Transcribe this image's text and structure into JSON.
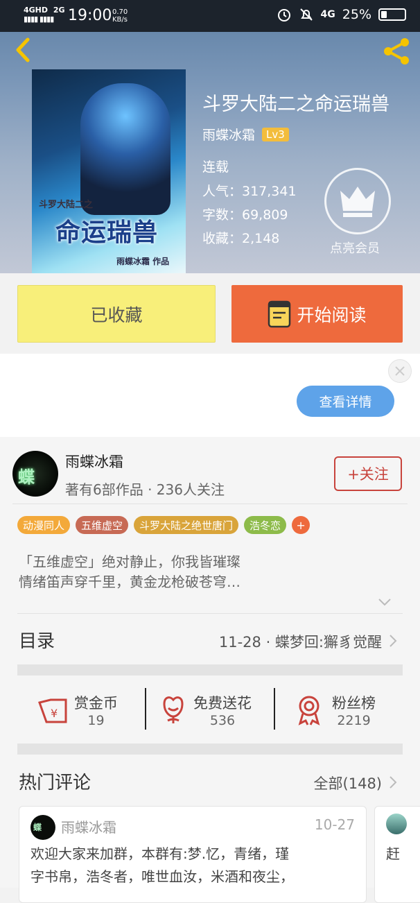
{
  "status_bar": {
    "network_line1": "4GHD",
    "network_line2": "2G",
    "time": "19:00",
    "speed_value": "0.70",
    "speed_unit": "KB/s",
    "signal_right": "4G",
    "battery": "25%"
  },
  "header": {
    "back_icon": "chevron-left-icon",
    "share_icon": "share-icon"
  },
  "book": {
    "cover_text_series": "斗罗大陆二之",
    "cover_text_title": "命运瑞兽",
    "cover_text_author": "雨蝶冰霜 作品",
    "title": "斗罗大陆二之命运瑞兽",
    "author": "雨蝶冰霜",
    "author_level": "Lv3",
    "status": "连载",
    "popularity": "人气：317,341",
    "word_count": "字数：69,809",
    "favorites": "收藏：2,148",
    "vip_label": "点亮会员"
  },
  "actions": {
    "favorited_label": "已收藏",
    "read_label": "开始阅读"
  },
  "ad": {
    "details_label": "查看详情"
  },
  "author_card": {
    "avatar_text": "蝶",
    "name": "雨蝶冰霜",
    "subtitle": "著有6部作品 · 236人关注",
    "follow_label": "+关注"
  },
  "tags": [
    {
      "label": "动漫同人",
      "color": "#f3a93a"
    },
    {
      "label": "五维虚空",
      "color": "#c76a55"
    },
    {
      "label": "斗罗大陆之绝世唐门",
      "color": "#d9a43a"
    },
    {
      "label": "浩冬恋",
      "color": "#8dbb4a"
    }
  ],
  "tag_more": "+",
  "description": {
    "line1": "「五维虚空」绝对静止，你我皆璀璨",
    "line2": "情绪笛声穿千里，黄金龙枪破苍穹…"
  },
  "toc": {
    "title": "目录",
    "latest": "11-28 · 蝶梦回:獬豸觉醒"
  },
  "stats": [
    {
      "label": "赏金币",
      "value": "19",
      "icon": "coin-envelope-icon"
    },
    {
      "label": "免费送花",
      "value": "536",
      "icon": "flower-icon"
    },
    {
      "label": "粉丝榜",
      "value": "2219",
      "icon": "medal-icon"
    }
  ],
  "comments": {
    "title": "热门评论",
    "all_label": "全部(148)",
    "items": [
      {
        "name": "雨蝶冰霜",
        "date": "10-27",
        "line1": "欢迎大家来加群，本群有:梦.忆，青绪，瑾",
        "line2": "字书帛，浩冬者，唯世血汝，米酒和夜尘，"
      },
      {
        "text": "赶"
      }
    ]
  },
  "colors": {
    "accent_orange": "#ee6a3d",
    "favorited_yellow": "#f8ef7a",
    "follow_red": "#c8433c",
    "ad_button_blue": "#5ea3e9",
    "level_badge": "#f3bd3c"
  }
}
